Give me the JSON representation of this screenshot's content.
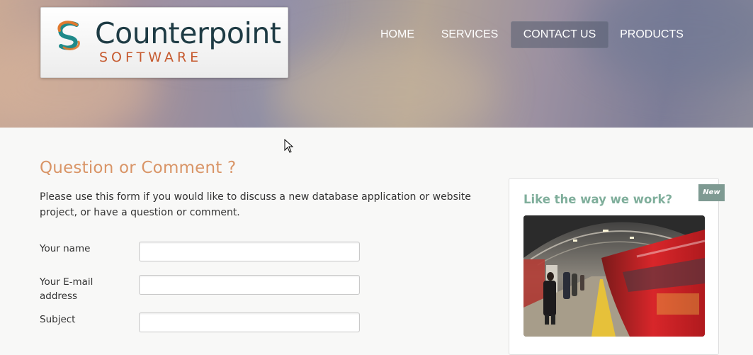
{
  "brand": {
    "name": "Counterpoint",
    "tagline": "SOFTWARE",
    "colors": {
      "title": "#1e3b44",
      "tagline": "#c65a2f",
      "mark_teal": "#1f8a8a",
      "mark_orange": "#e0792e"
    }
  },
  "nav": {
    "items": [
      {
        "label": "HOME",
        "active": false
      },
      {
        "label": "SERVICES",
        "active": false
      },
      {
        "label": "CONTACT US",
        "active": true
      },
      {
        "label": "PRODUCTS",
        "active": false
      }
    ]
  },
  "main": {
    "title": "Question or Comment ?",
    "intro": "Please use this form if you would like to discuss a new database application or website project, or have a question or comment.",
    "form": {
      "fields": [
        {
          "label": "Your name",
          "value": ""
        },
        {
          "label": "Your E-mail address",
          "value": ""
        },
        {
          "label": "Subject",
          "value": ""
        }
      ]
    },
    "colors": {
      "title": "#d99567"
    }
  },
  "sidebar": {
    "badge": "New",
    "title": "Like the way we work?",
    "photo_icon": "subway-train-photo",
    "colors": {
      "title": "#7fae9b",
      "badge": "#7e9a92"
    }
  },
  "cursor_icon": "arrow-cursor-icon"
}
